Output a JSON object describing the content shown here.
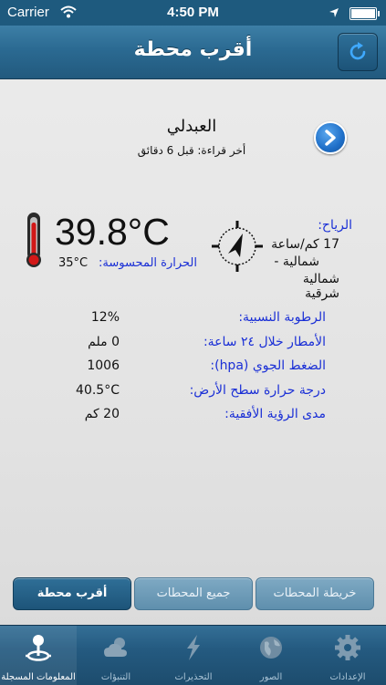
{
  "status_bar": {
    "carrier": "Carrier",
    "time": "4:50 PM"
  },
  "nav": {
    "title": "أقرب محطة"
  },
  "station": {
    "name": "العبدلي",
    "last_reading": "أخر قراءة: قبل 6 دقائق"
  },
  "temperature": {
    "value": "39.8°C",
    "feels_label": "الحرارة المحسوسة:",
    "feels_value": "35°C"
  },
  "wind": {
    "label": "الرياح:",
    "speed": "17 كم/ساعة",
    "direction_line1": "شمالية -",
    "direction_line2": "شمالية شرقية"
  },
  "details": [
    {
      "label": "الرطوبة النسبية:",
      "value": "12%"
    },
    {
      "label": "الأمطار خلال ٢٤ ساعة:",
      "value": "0 ملم"
    },
    {
      "label": "الضغط الجوي (hpa):",
      "value": "1006"
    },
    {
      "label": "درجة حرارة سطح الأرض:",
      "value": "40.5°C"
    },
    {
      "label": "مدى الرؤية الأفقية:",
      "value": "20 كم"
    }
  ],
  "segments": [
    {
      "label": "أقرب محطة",
      "active": true
    },
    {
      "label": "جميع المحطات",
      "active": false
    },
    {
      "label": "خريطة المحطات",
      "active": false
    }
  ],
  "tabs": [
    {
      "label": "المعلومات المسجلة",
      "icon": "station-icon",
      "active": true
    },
    {
      "label": "التنبؤات",
      "icon": "cloud-sun-icon",
      "active": false
    },
    {
      "label": "التحذيرات",
      "icon": "lightning-icon",
      "active": false
    },
    {
      "label": "الصور",
      "icon": "globe-icon",
      "active": false
    },
    {
      "label": "الإعدادات",
      "icon": "gear-icon",
      "active": false
    }
  ],
  "colors": {
    "accent": "#2b6a92",
    "label_blue": "#1a2fd6"
  }
}
